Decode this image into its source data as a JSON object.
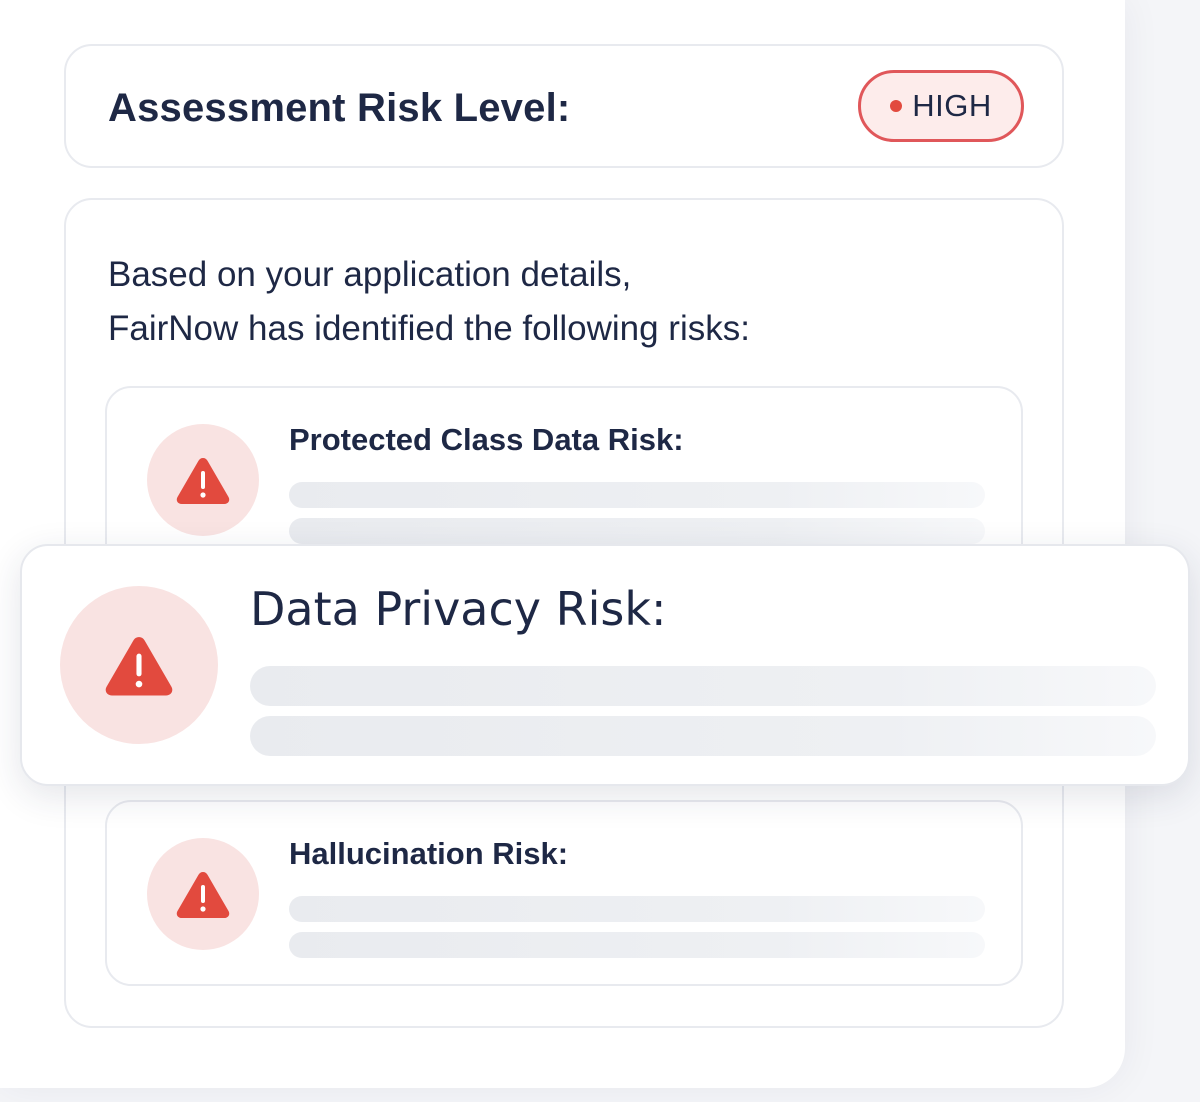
{
  "assessment": {
    "title": "Assessment Risk Level:",
    "level": "HIGH",
    "level_color": "#e24a3e"
  },
  "summary": {
    "line1": "Based on your application details,",
    "line2": "FairNow has identified the following risks:"
  },
  "risks": [
    {
      "name": "Protected Class Data Risk:",
      "icon": "warning-triangle-icon"
    },
    {
      "name": "Data Privacy Risk:",
      "icon": "warning-triangle-icon"
    },
    {
      "name": "Hallucination Risk:",
      "icon": "warning-triangle-icon"
    }
  ],
  "colors": {
    "alert_red": "#e24a3e",
    "alert_bg": "#f9e3e2",
    "text_dark": "#1e2845"
  }
}
